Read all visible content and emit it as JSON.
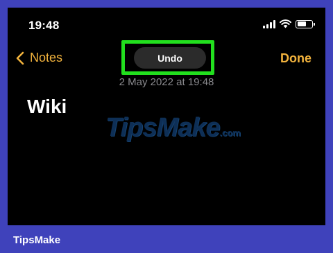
{
  "status_bar": {
    "time": "19:48",
    "icons": [
      "cellular-signal-icon",
      "wifi-icon",
      "battery-icon"
    ]
  },
  "nav": {
    "back_label": "Notes",
    "back_icon": "chevron-left-icon",
    "undo_label": "Undo",
    "done_label": "Done"
  },
  "note": {
    "date": "2 May 2022 at 19:48",
    "title": "Wiki"
  },
  "watermark": {
    "text": "TipsMake",
    "suffix": ".com"
  },
  "footer": {
    "brand": "TipsMake"
  },
  "colors": {
    "frame": "#3f42bb",
    "screen": "#000000",
    "accent": "#f2b33d",
    "highlight": "#22e01e",
    "undo_pill": "#2b2b2b",
    "date_text": "#8a8a8e"
  }
}
